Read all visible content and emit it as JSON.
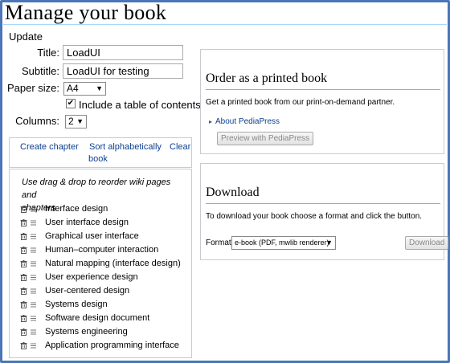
{
  "page": {
    "title": "Manage your book"
  },
  "form": {
    "section_label": "Update",
    "title_label": "Title:",
    "title_value": "LoadUI",
    "subtitle_label": "Subtitle:",
    "subtitle_value": "LoadUI for testing",
    "paper_size_label": "Paper size:",
    "paper_size_value": "A4",
    "toc_checked": true,
    "toc_label": "Include a table of contents",
    "columns_label": "Columns:",
    "columns_value": "2"
  },
  "actions": {
    "create_chapter": "Create chapter",
    "sort_alphabetically": "Sort alphabetically",
    "sort_alphabetically_line2": "book",
    "clear": "Clear"
  },
  "chapters": {
    "hint_line1": "Use drag & drop to reorder wiki pages and",
    "hint_line2": "chapters",
    "items": [
      "Interface design",
      "User interface design",
      "Graphical user interface",
      "Human–computer interaction",
      "Natural mapping (interface design)",
      "User experience design",
      "User-centered design",
      "Systems design",
      "Software design document",
      "Systems engineering",
      "Application programming interface"
    ]
  },
  "print": {
    "title": "Order as a printed book",
    "description": "Get a printed book from our print-on-demand partner.",
    "about_link": "About PediaPress",
    "preview_button": "Preview with PediaPress"
  },
  "download": {
    "title": "Download",
    "description": "To download your book choose a format and click the button.",
    "format_label": "Format:",
    "format_value": "e-book (PDF, mwlib renderer)",
    "download_button": "Download"
  },
  "colors": {
    "link": "#0b3f8f",
    "frame": "#4b76b8",
    "border": "#c8ccd1"
  }
}
